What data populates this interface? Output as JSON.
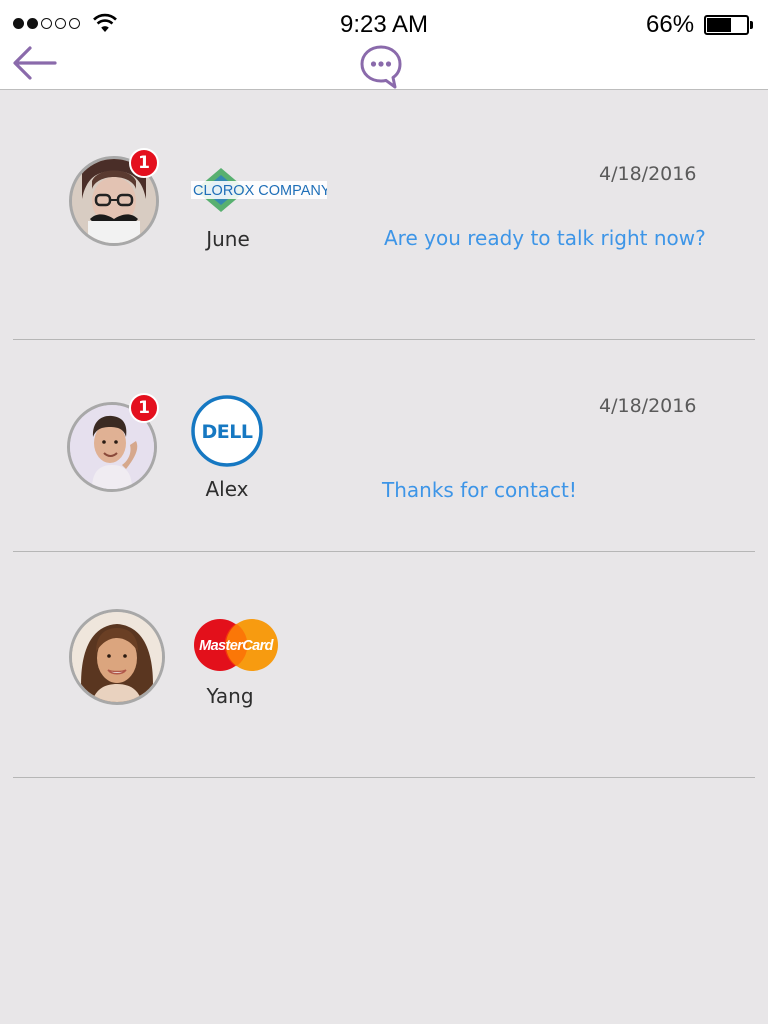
{
  "status_bar": {
    "time": "9:23 AM",
    "battery_percent": "66%",
    "battery_level": 0.66,
    "signal_bars_filled": 2,
    "signal_bars_total": 5
  },
  "nav": {
    "back_icon": "back-arrow-icon",
    "center_icon": "chat-bubble-icon"
  },
  "colors": {
    "accent": "#8a6aab",
    "message": "#3d95e7",
    "badge": "#e4101e",
    "background": "#e8e6e8"
  },
  "conversations": [
    {
      "name": "June",
      "company": "Clorox Company",
      "logo_text": "CLOROX COMPANY",
      "date": "4/18/2016",
      "last_message": "Are you ready to talk right now?",
      "unread": "1"
    },
    {
      "name": "Alex",
      "company": "Dell",
      "logo_text": "DELL",
      "date": "4/18/2016",
      "last_message": "Thanks for contact!",
      "unread": "1"
    },
    {
      "name": "Yang",
      "company": "MasterCard",
      "logo_text": "MasterCard",
      "date": "",
      "last_message": "",
      "unread": ""
    }
  ]
}
